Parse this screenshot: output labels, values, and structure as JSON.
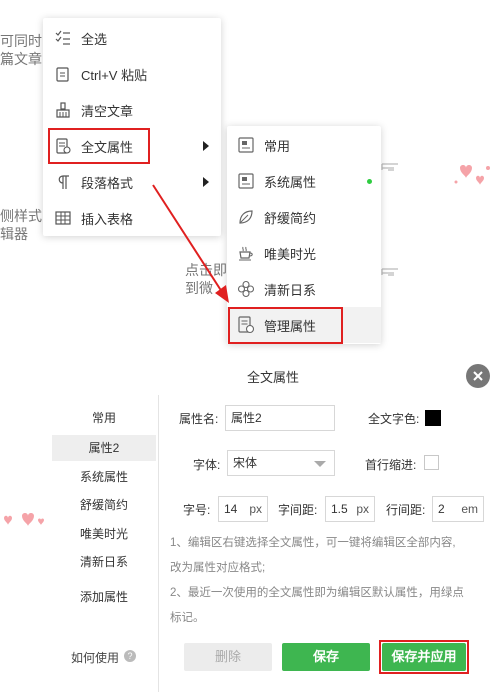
{
  "background_text": {
    "line1": "可同时",
    "line2": "篇文章",
    "line3": "侧样式",
    "line4": "辑器",
    "line5": "点击即",
    "line6": "到微"
  },
  "context_menu": {
    "items": [
      {
        "label": "全选",
        "icon": "select-all-icon"
      },
      {
        "label": "Ctrl+V 粘贴",
        "icon": "paste-icon"
      },
      {
        "label": "清空文章",
        "icon": "broom-icon"
      },
      {
        "label": "全文属性",
        "icon": "document-settings-icon",
        "has_submenu": true
      },
      {
        "label": "段落格式",
        "icon": "paragraph-icon",
        "has_submenu": true
      },
      {
        "label": "插入表格",
        "icon": "table-icon"
      }
    ]
  },
  "submenu": {
    "items": [
      {
        "label": "常用",
        "icon": "common-style-icon"
      },
      {
        "label": "系统属性",
        "icon": "system-style-icon",
        "active_dot": true
      },
      {
        "label": "舒缓简约",
        "icon": "leaf-icon"
      },
      {
        "label": "唯美时光",
        "icon": "coffee-cup-icon"
      },
      {
        "label": "清新日系",
        "icon": "flower-icon"
      },
      {
        "label": "管理属性",
        "icon": "manage-settings-icon"
      }
    ]
  },
  "dialog": {
    "title": "全文属性",
    "sidebar": [
      "常用",
      "属性2",
      "系统属性",
      "舒缓简约",
      "唯美时光",
      "清新日系",
      "添加属性"
    ],
    "selected_sidebar": "属性2",
    "howto": "如何使用",
    "form": {
      "name_label": "属性名:",
      "name_value": "属性2",
      "color_label": "全文字色:",
      "text_color": "#000000",
      "font_label": "字体:",
      "font_value": "宋体",
      "indent_label": "首行缩进:",
      "size_label": "字号:",
      "size_value": "14",
      "size_unit": "px",
      "spacing_label": "字间距:",
      "spacing_value": "1.5",
      "spacing_unit": "px",
      "line_label": "行间距:",
      "line_value": "2",
      "line_unit": "em"
    },
    "notes": [
      "1、编辑区右键选择全文属性，可一键将编辑区全部内容,",
      "改为属性对应格式;",
      "2、最近一次使用的全文属性即为编辑区默认属性，用绿点",
      "标记。"
    ],
    "buttons": {
      "delete": "删除",
      "save": "保存",
      "save_apply": "保存并应用"
    }
  },
  "colors": {
    "accent_green": "#3eb650",
    "highlight_red": "#e02020"
  }
}
